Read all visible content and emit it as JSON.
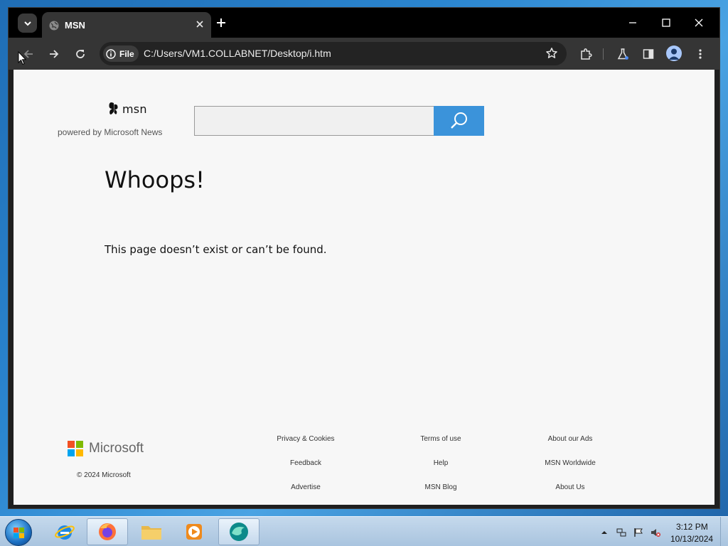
{
  "browser": {
    "tab_title": "MSN",
    "site_chip_label": "File",
    "url": "C:/Users/VM1.COLLABNET/Desktop/i.htm"
  },
  "page": {
    "msn_wordmark": "msn",
    "powered_by": "powered by Microsoft News",
    "search": {
      "value": "",
      "placeholder": ""
    },
    "headline": "Whoops!",
    "message": "This page doesn’t exist or can’t be found.",
    "footer": {
      "brand": "Microsoft",
      "copyright": "© 2024 Microsoft",
      "links": [
        [
          "Privacy & Cookies",
          "Terms of use",
          "About our Ads"
        ],
        [
          "Feedback",
          "Help",
          "MSN Worldwide"
        ],
        [
          "Advertise",
          "MSN Blog",
          "About Us"
        ]
      ]
    }
  },
  "taskbar": {
    "apps": [
      "internet-explorer",
      "firefox",
      "file-explorer",
      "media-player",
      "browser"
    ],
    "clock_time": "3:12 PM",
    "clock_date": "10/13/2024"
  },
  "colors": {
    "search_button": "#3b93da",
    "ms_red": "#f25022",
    "ms_green": "#7fba00",
    "ms_blue": "#00a4ef",
    "ms_yellow": "#ffb900"
  }
}
